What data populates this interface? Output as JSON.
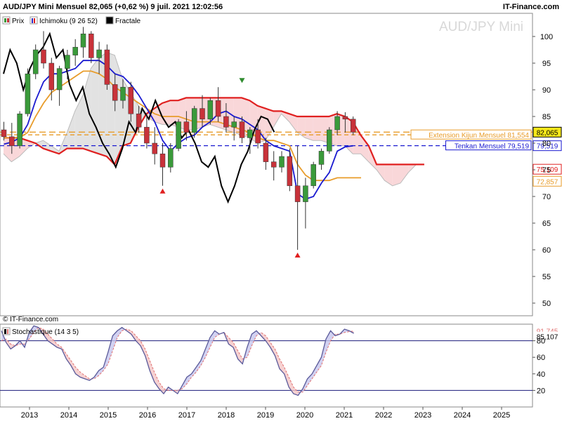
{
  "header": {
    "title": "AUD/JPY Mini Mensuel 82,065 (+0,62 %) 9 juil. 2021 12:02:56",
    "brand": "IT-Finance.com",
    "watermark": "AUD/JPY Mini",
    "copyright": "© IT-Finance.com"
  },
  "legend": {
    "items": [
      {
        "label": "Prix",
        "icon": "candlestick-icon",
        "color": "#2e8b2e"
      },
      {
        "label": "Ichimoku (9 26 52)",
        "icon": "ichimoku-icon",
        "color": "#2b2bc8"
      },
      {
        "label": "Fractale",
        "icon": "fractal-icon",
        "color": "#000000"
      }
    ],
    "stoch_label": "Stochastique (14 3 5)"
  },
  "colors": {
    "up": "#3a9a3a",
    "down": "#c8323a",
    "tenkan": "#1a1ad0",
    "kijun": "#e89c2a",
    "senkou_b": "#e02020",
    "chikou": "#000000",
    "cloud_bear": "#f7c9cc",
    "cloud_bull": "#d8d8d8",
    "stoch_k": "#5a5a9a",
    "stoch_d": "#e07070"
  },
  "chart_data": [
    {
      "type": "candlestick",
      "name": "price",
      "y_ticks": [
        50,
        55,
        60,
        65,
        70,
        75,
        80,
        85,
        90,
        95,
        100
      ],
      "y_tick_labels": [
        "50",
        "55",
        "60",
        "65",
        "70",
        "75",
        "80",
        "85",
        "90",
        "95",
        "100"
      ],
      "x_ticks": [
        "2013",
        "2014",
        "2015",
        "2016",
        "2017",
        "2018",
        "2019",
        "2020",
        "2021",
        "2022",
        "2023",
        "2024",
        "2025"
      ],
      "ohlc": [
        [
          82.5,
          84.0,
          80.5,
          81.2
        ],
        [
          81.2,
          83.8,
          78.0,
          79.5
        ],
        [
          79.5,
          86.0,
          79.0,
          85.5
        ],
        [
          85.5,
          94.0,
          85.0,
          93.0
        ],
        [
          93.0,
          98.5,
          92.0,
          97.5
        ],
        [
          97.5,
          101.0,
          94.0,
          95.0
        ],
        [
          95.0,
          96.0,
          88.0,
          90.0
        ],
        [
          90.0,
          94.5,
          87.0,
          94.0
        ],
        [
          94.0,
          97.5,
          92.0,
          96.5
        ],
        [
          96.5,
          99.5,
          94.5,
          98.0
        ],
        [
          98.0,
          101.8,
          96.0,
          100.5
        ],
        [
          100.5,
          101.0,
          95.0,
          96.0
        ],
        [
          96.0,
          99.0,
          93.0,
          97.5
        ],
        [
          97.5,
          98.5,
          90.0,
          91.0
        ],
        [
          91.0,
          93.0,
          86.0,
          88.0
        ],
        [
          88.0,
          92.0,
          86.5,
          90.5
        ],
        [
          90.5,
          91.5,
          84.0,
          85.5
        ],
        [
          85.5,
          87.0,
          82.0,
          83.0
        ],
        [
          83.0,
          85.5,
          79.0,
          80.0
        ],
        [
          80.0,
          83.0,
          76.0,
          78.0
        ],
        [
          78.0,
          80.0,
          72.0,
          75.5
        ],
        [
          75.5,
          80.0,
          74.5,
          79.0
        ],
        [
          79.0,
          84.5,
          78.5,
          84.0
        ],
        [
          84.0,
          86.0,
          80.5,
          82.0
        ],
        [
          82.0,
          87.0,
          81.0,
          86.5
        ],
        [
          86.5,
          89.0,
          83.0,
          84.5
        ],
        [
          84.5,
          88.5,
          83.5,
          88.0
        ],
        [
          88.0,
          90.5,
          84.0,
          85.0
        ],
        [
          85.0,
          87.5,
          82.0,
          83.0
        ],
        [
          83.0,
          85.0,
          80.5,
          84.0
        ],
        [
          84.0,
          85.0,
          80.0,
          81.0
        ],
        [
          81.0,
          83.0,
          78.0,
          82.5
        ],
        [
          82.5,
          84.5,
          79.0,
          80.0
        ],
        [
          80.0,
          81.0,
          75.0,
          76.5
        ],
        [
          76.5,
          78.5,
          73.0,
          75.5
        ],
        [
          75.5,
          78.5,
          74.5,
          77.5
        ],
        [
          77.5,
          79.0,
          71.0,
          72.0
        ],
        [
          72.0,
          79.5,
          60.0,
          69.0
        ],
        [
          69.0,
          73.5,
          64.0,
          72.0
        ],
        [
          72.0,
          76.5,
          71.5,
          76.0
        ],
        [
          76.0,
          79.0,
          75.0,
          78.5
        ],
        [
          78.5,
          83.0,
          78.0,
          82.5
        ],
        [
          82.5,
          86.0,
          81.5,
          85.0
        ],
        [
          85.0,
          85.8,
          82.0,
          84.5
        ],
        [
          84.5,
          85.0,
          81.5,
          82.065
        ]
      ],
      "tenkan": [
        79.8,
        80.2,
        81.0,
        83.5,
        88.0,
        91.5,
        93.0,
        93.0,
        93.5,
        94.0,
        95.5,
        95.5,
        95.5,
        94.5,
        93.0,
        92.5,
        91.0,
        89.0,
        86.5,
        84.0,
        80.5,
        78.5,
        80.0,
        81.0,
        81.5,
        83.0,
        84.0,
        85.5,
        86.0,
        85.0,
        84.5,
        83.5,
        82.5,
        80.5,
        79.5,
        79.0,
        78.5,
        70.5,
        69.5,
        70.0,
        72.5,
        74.5,
        78.5,
        79.3,
        79.519
      ],
      "kijun": [
        81.0,
        81.0,
        81.0,
        82.0,
        85.0,
        87.5,
        89.5,
        90.5,
        91.5,
        92.5,
        93.5,
        93.5,
        93.0,
        92.0,
        90.5,
        89.5,
        88.5,
        87.5,
        86.5,
        85.5,
        85.0,
        85.0,
        85.0,
        84.5,
        84.0,
        84.0,
        84.0,
        84.0,
        83.5,
        83.0,
        82.5,
        82.0,
        81.0,
        80.5,
        80.5,
        80.0,
        79.5,
        76.0,
        74.0,
        73.0,
        73.0,
        73.0,
        73.5,
        73.5,
        73.5,
        73.5
      ],
      "senkou_b": [
        81.0,
        81.0,
        81.0,
        80.5,
        80.0,
        79.0,
        78.5,
        78.0,
        79.0,
        79.0,
        79.0,
        78.5,
        78.0,
        77.5,
        76.0,
        79.5,
        80.0,
        83.0,
        85.5,
        86.5,
        87.5,
        88.0,
        88.0,
        88.5,
        88.5,
        88.5,
        88.5,
        88.5,
        88.5,
        88.5,
        88.5,
        88.0,
        87.0,
        86.5,
        86.0,
        86.0,
        85.5,
        85.0,
        85.0,
        85.0,
        85.0,
        85.0,
        85.5,
        85.0,
        84.0,
        81.5,
        79.5,
        76.0,
        76.0,
        76.0,
        76.0,
        76.0,
        76.0,
        76.0
      ],
      "senkou_a": [
        78.0,
        76.5,
        77.5,
        79.0,
        80.0,
        80.5,
        79.5,
        78.5,
        82.0,
        86.0,
        89.0,
        94.0,
        96.0,
        97.0,
        96.5,
        92.0,
        89.5,
        87.0,
        85.0,
        84.0,
        83.5,
        83.5,
        83.0,
        82.5,
        82.5,
        83.0,
        83.5,
        83.0,
        82.5,
        82.0,
        81.5,
        81.0,
        80.0,
        80.5,
        83.0,
        85.5,
        84.0,
        82.0,
        81.0,
        80.5,
        80.5,
        80.0,
        79.5,
        79.5,
        78.0,
        78.0,
        76.5,
        75.0,
        73.0,
        72.0,
        72.5,
        74.5,
        76.0,
        76.0
      ],
      "chikou": [
        93.0,
        97.5,
        95.0,
        90.0,
        94.0,
        96.5,
        98.0,
        100.5,
        96.0,
        97.5,
        91.0,
        88.0,
        90.5,
        85.5,
        83.0,
        80.0,
        78.0,
        75.5,
        79.0,
        84.0,
        82.0,
        86.5,
        84.5,
        88.0,
        85.0,
        83.0,
        84.0,
        81.0,
        82.5,
        80.0,
        76.5,
        75.5,
        77.5,
        72.0,
        69.0,
        72.0,
        76.0,
        78.5,
        82.5,
        85.0,
        84.5,
        82.065
      ],
      "current_price": 82.065,
      "fractals_up": [
        {
          "index": 30,
          "value": 90.5
        }
      ],
      "fractals_down": [
        {
          "index": 20,
          "value": 72.0
        },
        {
          "index": 37,
          "value": 60.0
        }
      ],
      "annotations": [
        {
          "text": "Extension Kijun Mensuel 81,554",
          "value": 81.554,
          "color": "#e89c2a"
        },
        {
          "text": "Tenkan Mensuel 79,519",
          "value": 79.519,
          "color": "#1a1ad0"
        }
      ],
      "price_tags": [
        {
          "text": "82,065",
          "value": 82.065,
          "bg": "#f6e81a",
          "fg": "#000000",
          "border": "#000000"
        },
        {
          "text": "79,519",
          "value": 79.519,
          "bg": "#ffffff",
          "fg": "#1a1ad0",
          "border": "#1a1ad0"
        },
        {
          "text": "75,109",
          "value": 75.109,
          "bg": "#ffffff",
          "fg": "#e02020",
          "border": "#e02020"
        },
        {
          "text": "72,857",
          "value": 72.857,
          "bg": "#ffffff",
          "fg": "#e89c2a",
          "border": "#e89c2a"
        }
      ]
    },
    {
      "type": "line",
      "name": "stochastic",
      "ylim": [
        0,
        100
      ],
      "y_ticks": [
        20,
        40,
        60,
        80
      ],
      "y_tick_labels": [
        "20",
        "40",
        "60",
        "80"
      ],
      "levels": [
        20,
        80
      ],
      "k": [
        92,
        78,
        70,
        74,
        80,
        72,
        90,
        98,
        96,
        88,
        80,
        76,
        72,
        70,
        58,
        50,
        40,
        36,
        34,
        32,
        36,
        44,
        48,
        66,
        86,
        92,
        96,
        92,
        88,
        80,
        74,
        62,
        44,
        30,
        22,
        16,
        24,
        20,
        16,
        26,
        36,
        40,
        48,
        56,
        70,
        84,
        92,
        88,
        90,
        76,
        72,
        58,
        52,
        72,
        88,
        92,
        86,
        80,
        72,
        62,
        46,
        40,
        24,
        16,
        14,
        22,
        34,
        40,
        50,
        60,
        82,
        92,
        86,
        88,
        94,
        92,
        89
      ],
      "d": [
        80,
        82,
        76,
        74,
        76,
        76,
        82,
        90,
        96,
        94,
        88,
        82,
        76,
        72,
        64,
        56,
        48,
        42,
        38,
        34,
        34,
        38,
        44,
        52,
        68,
        84,
        92,
        94,
        92,
        86,
        80,
        70,
        56,
        42,
        30,
        22,
        20,
        20,
        20,
        22,
        28,
        36,
        42,
        50,
        60,
        72,
        84,
        88,
        90,
        84,
        78,
        68,
        58,
        60,
        74,
        86,
        90,
        86,
        78,
        70,
        58,
        48,
        36,
        24,
        18,
        18,
        26,
        34,
        42,
        50,
        66,
        80,
        88,
        88,
        90,
        91,
        91.745
      ],
      "tags": [
        {
          "text": "91,745",
          "value": 91.745,
          "fg": "#e07070"
        },
        {
          "text": "85,107",
          "value": 85.107,
          "fg": "#000000"
        }
      ]
    }
  ]
}
